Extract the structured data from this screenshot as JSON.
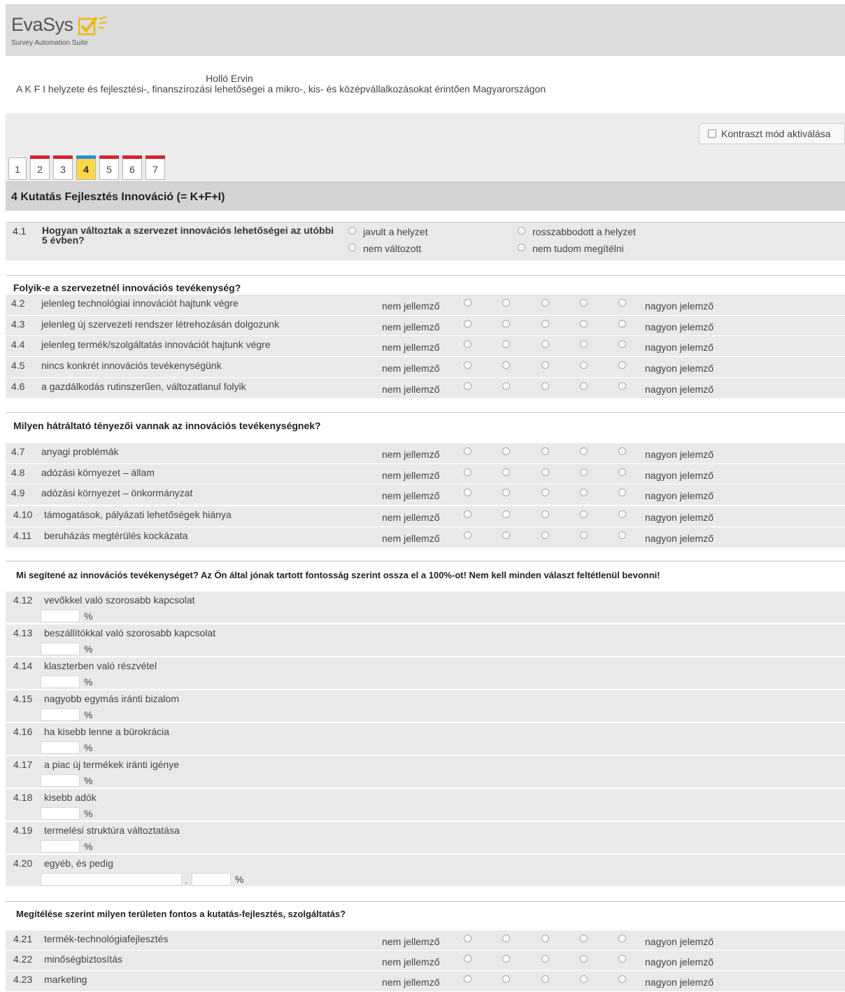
{
  "header": {
    "logo_text": "EvaSys",
    "logo_subtitle": "Survey Automation Suite"
  },
  "survey": {
    "author": "Holló Ervin",
    "subject": "A K F I helyzete és fejlesztési-, finanszírozási lehetőségei a mikro-, kis- és középvállalkozásokat érintően Magyarországon"
  },
  "contrast_toggle": {
    "label": "Kontraszt mód aktiválása"
  },
  "colors": {
    "tab_incomplete": "#d9232f",
    "tab_current": "#2d8fd0",
    "tab_active_bg": "#ffd84a"
  },
  "tabs": [
    {
      "label": "1",
      "bar": "none"
    },
    {
      "label": "2",
      "bar": "red"
    },
    {
      "label": "3",
      "bar": "red"
    },
    {
      "label": "4",
      "bar": "blue",
      "active": true
    },
    {
      "label": "5",
      "bar": "red"
    },
    {
      "label": "6",
      "bar": "red"
    },
    {
      "label": "7",
      "bar": "red"
    }
  ],
  "section": {
    "title": "4  Kutatás Fejlesztés Innováció (= K+F+I)"
  },
  "q41": {
    "num": "4.1",
    "text": "Hogyan változtak a szervezet innovációs lehetőségei az utóbbi 5 évben?",
    "options": [
      "javult a helyzet",
      "nem változott",
      "rosszabbodott a helyzet",
      "nem tudom megítélni"
    ]
  },
  "scale": {
    "low": "nem jellemző",
    "high": "nagyon jelemző"
  },
  "block1": {
    "title": "Folyik-e a szervezetnél innovációs tevékenység?",
    "items": [
      {
        "num": "4.2",
        "label": "jelenleg technológiai innovációt hajtunk végre"
      },
      {
        "num": "4.3",
        "label": "jelenleg új szervezeti rendszer létrehozásán dolgozunk"
      },
      {
        "num": "4.4",
        "label": "jelenleg termék/szolgáltatás innovációt hajtunk végre"
      },
      {
        "num": "4.5",
        "label": "nincs konkrét innovációs tevékenységünk"
      },
      {
        "num": "4.6",
        "label": "a gazdálkodás rutinszerűen, változatlanul folyik"
      }
    ]
  },
  "block2": {
    "title": "Milyen hátráltató tényezői vannak az innovációs tevékenységnek?",
    "items": [
      {
        "num": "4.7",
        "label": "anyagi problémák"
      },
      {
        "num": "4.8",
        "label": "adózási környezet – állam"
      },
      {
        "num": "4.9",
        "label": "adózási környezet – önkormányzat"
      },
      {
        "num": "4.10",
        "label": "támogatások, pályázati lehetőségek hiánya"
      },
      {
        "num": "4.11",
        "label": "beruházás megtérülés kockázata"
      }
    ]
  },
  "block3": {
    "title": "Mi segítené az innovációs tevékenységet? Az Ön által jónak tartott fontosság szerint ossza el a 100%-ot! Nem kell minden választ feltétlenül bevonni!",
    "pct_sign": "%",
    "sep": ".",
    "items": [
      {
        "num": "4.12",
        "label": "vevőkkel való szorosabb kapcsolat"
      },
      {
        "num": "4.13",
        "label": "beszállítókkal való szorosabb kapcsolat"
      },
      {
        "num": "4.14",
        "label": "klaszterben való részvétel"
      },
      {
        "num": "4.15",
        "label": "nagyobb egymás iránti bizalom"
      },
      {
        "num": "4.16",
        "label": "ha kisebb lenne a bürokrácia"
      },
      {
        "num": "4.17",
        "label": "a piac új termékek iránti igénye"
      },
      {
        "num": "4.18",
        "label": "kisebb adók"
      },
      {
        "num": "4.19",
        "label": "termelési struktúra változtatása"
      },
      {
        "num": "4.20",
        "label": "egyéb, és pedig"
      }
    ]
  },
  "block4": {
    "title": "Megítélése szerint milyen területen fontos a kutatás-fejlesztés, szolgáltatás?",
    "items": [
      {
        "num": "4.21",
        "label": "termék-technológiafejlesztés"
      },
      {
        "num": "4.22",
        "label": "minőségbiztosítás"
      },
      {
        "num": "4.23",
        "label": "marketing"
      }
    ]
  }
}
